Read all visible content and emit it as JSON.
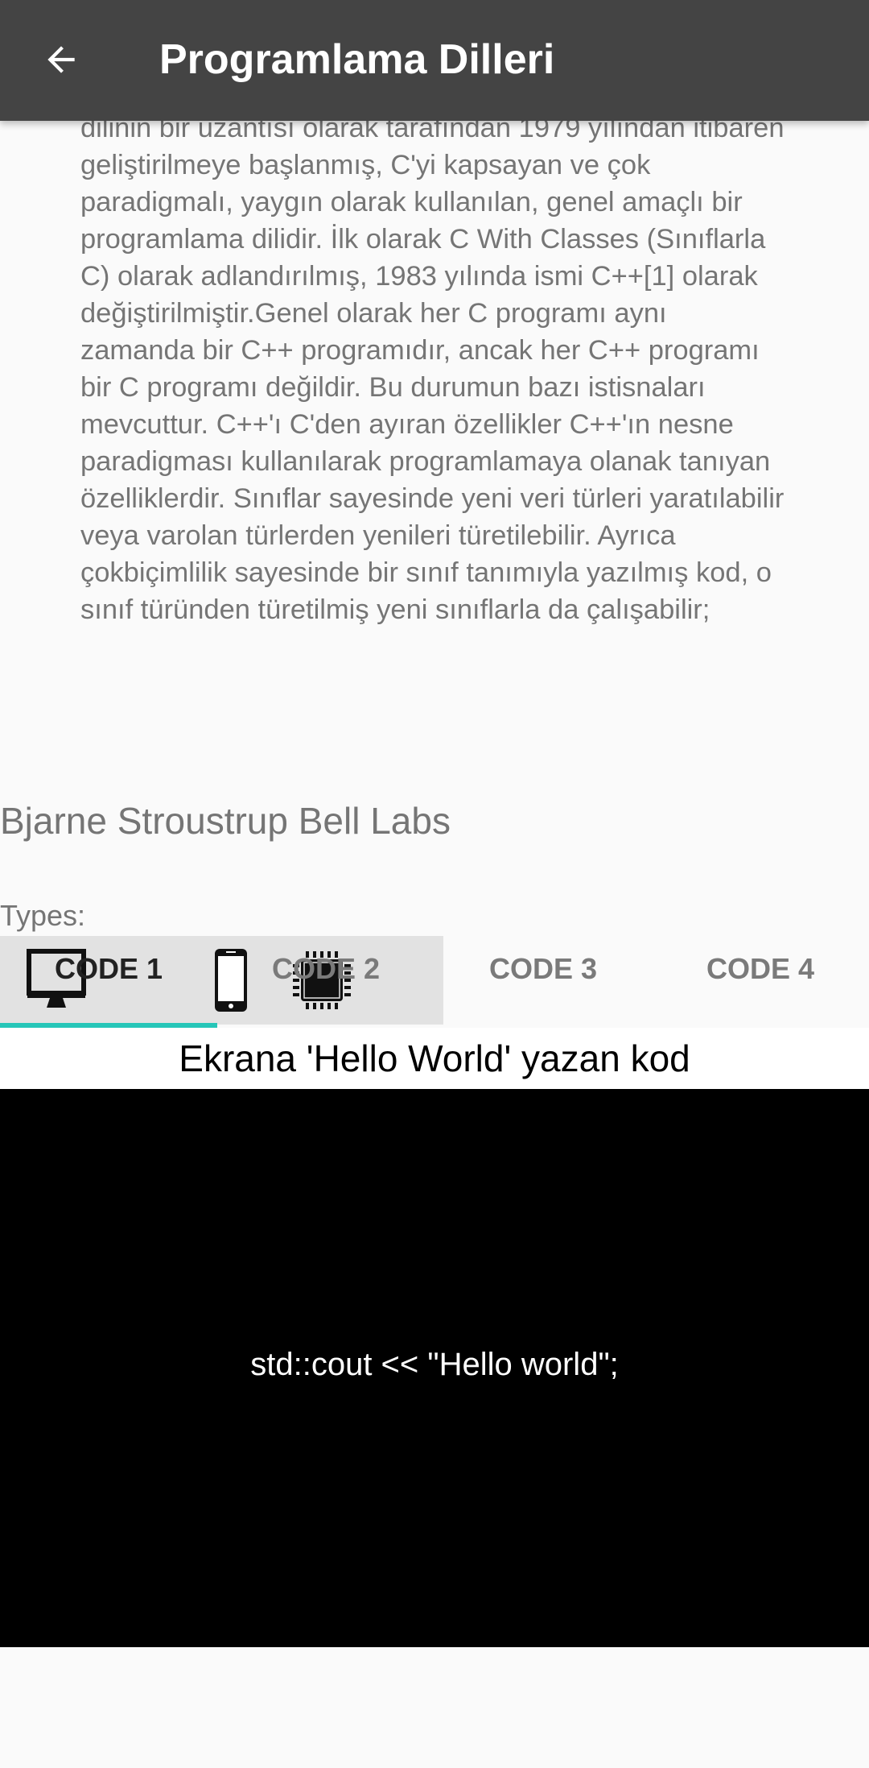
{
  "appbar": {
    "title": "Programlama Dilleri",
    "back_icon": "arrow-back-icon"
  },
  "description": "Bjarne Stroustrup tarafından Bell Labs'ta C programlama dilinin bir uzantısı olarak tarafından 1979 yılından itibaren geliştirilmeye başlanmış, C'yi kapsayan ve çok paradigmalı, yaygın olarak kullanılan, genel amaçlı bir programlama dilidir. İlk olarak C With Classes (Sınıflarla C) olarak adlandırılmış, 1983 yılında ismi C++[1] olarak değiştirilmiştir.Genel olarak her C programı aynı zamanda bir C++ programıdır, ancak her C++ programı bir C programı değildir. Bu durumun bazı istisnaları mevcuttur. C++'ı C'den ayıran özellikler C++'ın nesne paradigması kullanılarak programlamaya olanak tanıyan özelliklerdir. Sınıflar sayesinde yeni veri türleri yaratılabilir veya varolan türlerden yenileri türetilebilir. Ayrıca çokbiçimlilik sayesinde bir sınıf tanımıyla yazılmış kod, o sınıf türünden türetilmiş yeni sınıflarla da çalışabilir;",
  "creator": "Bjarne Stroustrup Bell Labs",
  "types": {
    "label": "Types:",
    "icons": [
      "desktop-icon",
      "mobile-phone-icon",
      "chip-icon"
    ]
  },
  "tabs": [
    {
      "label": "CODE 1",
      "active": true
    },
    {
      "label": "CODE 2",
      "active": false
    },
    {
      "label": "CODE 3",
      "active": false
    },
    {
      "label": "CODE 4",
      "active": false
    }
  ],
  "code": {
    "caption": "Ekrana 'Hello World' yazan kod",
    "snippet": "std::cout << \"Hello world\";"
  },
  "colors": {
    "appbar": "#444444",
    "background": "#fafafa",
    "accent": "#26c6b8",
    "code_background": "#000000"
  }
}
